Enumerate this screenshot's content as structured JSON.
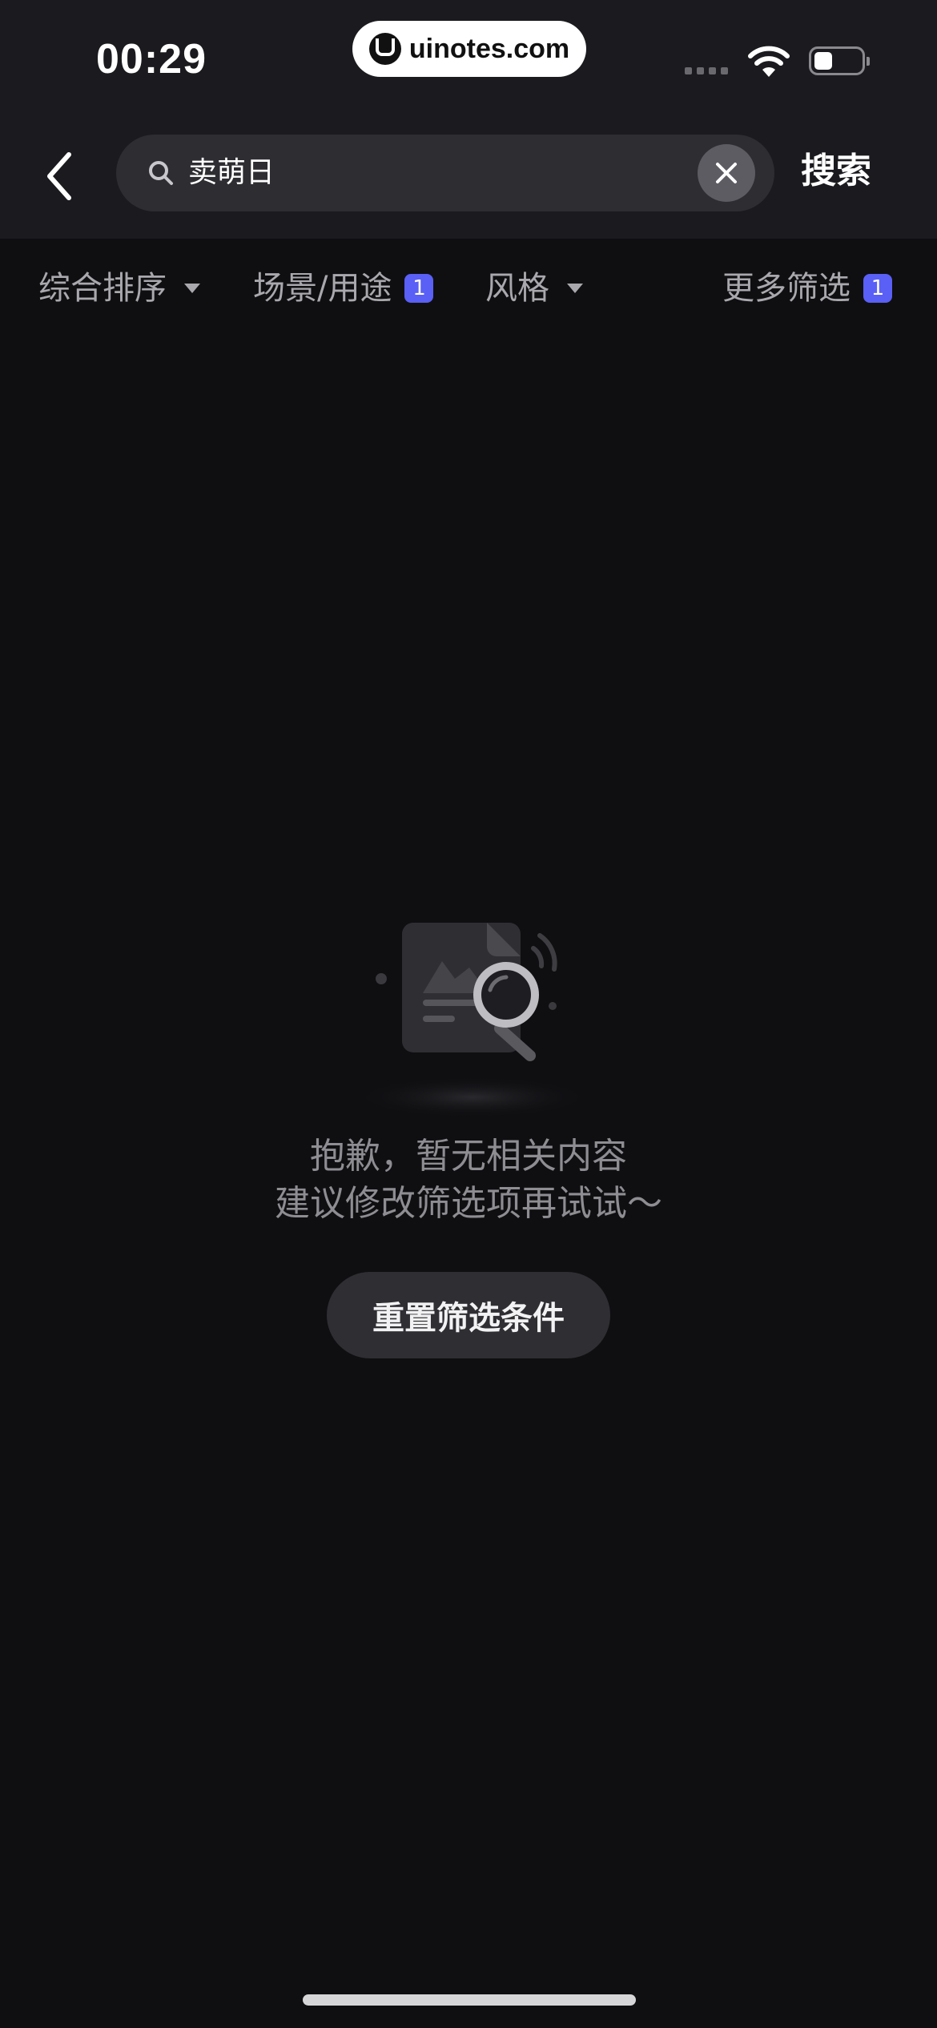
{
  "status_bar": {
    "time": "00:29",
    "watermark": "uinotes.com"
  },
  "header": {
    "search_value": "卖萌日",
    "search_button": "搜索"
  },
  "filters": [
    {
      "label": "综合排序",
      "has_caret": true,
      "badge": null
    },
    {
      "label": "场景/用途",
      "has_caret": false,
      "badge": "1"
    },
    {
      "label": "风格",
      "has_caret": true,
      "badge": null
    },
    {
      "label": "更多筛选",
      "has_caret": false,
      "badge": "1"
    }
  ],
  "empty_state": {
    "title": "抱歉，暂无相关内容",
    "subtitle": "建议修改筛选项再试试～",
    "reset_button": "重置筛选条件"
  },
  "colors": {
    "background": "#0f0f12",
    "header": "#1b1b1f",
    "badge": "#5a5ff5",
    "text_secondary": "#a8a8ad"
  },
  "icons": {
    "back": "chevron-left-icon",
    "search": "search-icon",
    "clear": "close-icon",
    "empty": "no-results-illustration"
  }
}
